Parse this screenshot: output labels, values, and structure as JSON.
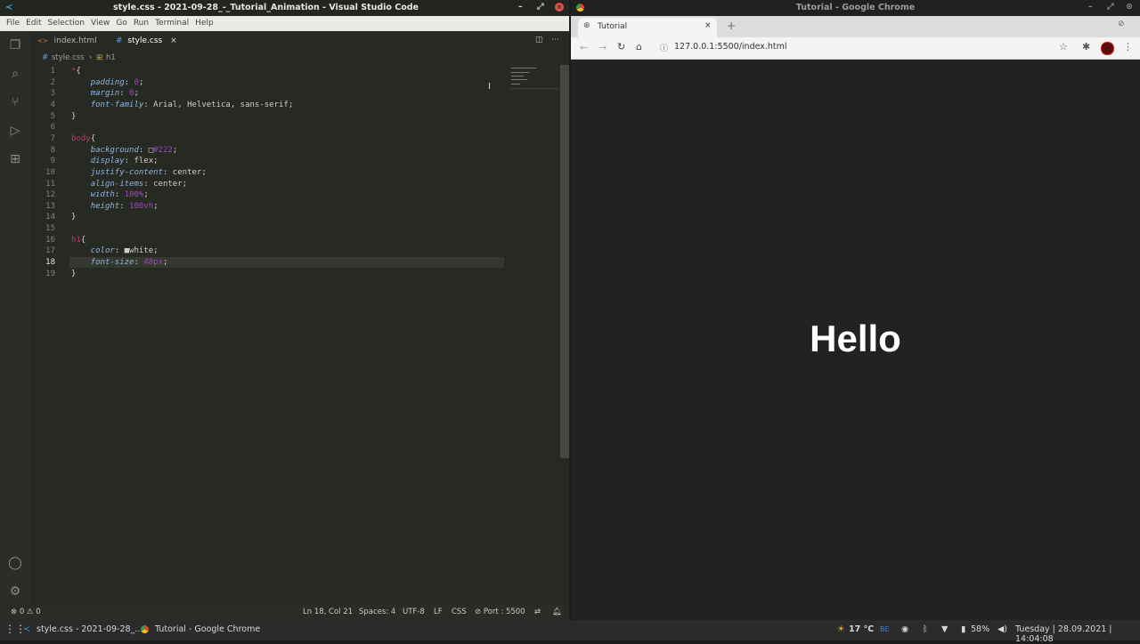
{
  "vscode": {
    "title": "style.css - 2021-09-28_-_Tutorial_Animation - Visual Studio Code",
    "menu": [
      "File",
      "Edit",
      "Selection",
      "View",
      "Go",
      "Run",
      "Terminal",
      "Help"
    ],
    "tabs": [
      {
        "label": "index.html",
        "icon": "<>"
      },
      {
        "label": "style.css",
        "icon": "#"
      }
    ],
    "breadcrumb": {
      "file": "style.css",
      "symbol": "h1"
    },
    "code": [
      {
        "n": "1",
        "parts": [
          [
            "sel",
            "*"
          ],
          [
            "val",
            "{"
          ]
        ]
      },
      {
        "n": "2",
        "parts": [
          [
            "val",
            "    "
          ],
          [
            "prop",
            "padding"
          ],
          [
            "val",
            ": "
          ],
          [
            "num",
            "0"
          ],
          [
            "val",
            ";"
          ]
        ]
      },
      {
        "n": "3",
        "parts": [
          [
            "val",
            "    "
          ],
          [
            "prop",
            "margin"
          ],
          [
            "val",
            ": "
          ],
          [
            "num",
            "0"
          ],
          [
            "val",
            ";"
          ]
        ]
      },
      {
        "n": "4",
        "parts": [
          [
            "val",
            "    "
          ],
          [
            "prop",
            "font-family"
          ],
          [
            "val",
            ": Arial, Helvetica, sans-serif;"
          ]
        ]
      },
      {
        "n": "5",
        "parts": [
          [
            "val",
            "}"
          ]
        ]
      },
      {
        "n": "6",
        "parts": []
      },
      {
        "n": "7",
        "parts": [
          [
            "sel",
            "body"
          ],
          [
            "val",
            "{"
          ]
        ]
      },
      {
        "n": "8",
        "parts": [
          [
            "val",
            "    "
          ],
          [
            "prop",
            "background"
          ],
          [
            "val",
            ": □"
          ],
          [
            "num",
            "#222"
          ],
          [
            "val",
            ";"
          ]
        ]
      },
      {
        "n": "9",
        "parts": [
          [
            "val",
            "    "
          ],
          [
            "prop",
            "display"
          ],
          [
            "val",
            ": flex;"
          ]
        ]
      },
      {
        "n": "10",
        "parts": [
          [
            "val",
            "    "
          ],
          [
            "prop",
            "justify-content"
          ],
          [
            "val",
            ": center;"
          ]
        ]
      },
      {
        "n": "11",
        "parts": [
          [
            "val",
            "    "
          ],
          [
            "prop",
            "align-items"
          ],
          [
            "val",
            ": center;"
          ]
        ]
      },
      {
        "n": "12",
        "parts": [
          [
            "val",
            "    "
          ],
          [
            "prop",
            "width"
          ],
          [
            "val",
            ": "
          ],
          [
            "num",
            "100%"
          ],
          [
            "val",
            ";"
          ]
        ]
      },
      {
        "n": "13",
        "parts": [
          [
            "val",
            "    "
          ],
          [
            "prop",
            "height"
          ],
          [
            "val",
            ": "
          ],
          [
            "num",
            "100vh"
          ],
          [
            "val",
            ";"
          ]
        ]
      },
      {
        "n": "14",
        "parts": [
          [
            "val",
            "}"
          ]
        ]
      },
      {
        "n": "15",
        "parts": []
      },
      {
        "n": "16",
        "parts": [
          [
            "sel",
            "h1"
          ],
          [
            "val",
            "{"
          ]
        ]
      },
      {
        "n": "17",
        "parts": [
          [
            "val",
            "    "
          ],
          [
            "prop",
            "color"
          ],
          [
            "val",
            ": ■white;"
          ]
        ]
      },
      {
        "n": "18",
        "parts": [
          [
            "val",
            "    "
          ],
          [
            "prop",
            "font-size"
          ],
          [
            "val",
            ": "
          ],
          [
            "num",
            "48px"
          ],
          [
            "val",
            ";"
          ]
        ]
      },
      {
        "n": "19",
        "parts": [
          [
            "val",
            "}"
          ]
        ]
      }
    ],
    "status": {
      "problems": "⊗ 0 ⚠ 0",
      "position": "Ln 18, Col 21",
      "spaces": "Spaces: 4",
      "encoding": "UTF-8",
      "eol": "LF",
      "language": "CSS",
      "port": "⊘ Port : 5500"
    }
  },
  "chrome": {
    "title": "Tutorial - Google Chrome",
    "tab_label": "Tutorial",
    "url": "127.0.0.1:5500/index.html",
    "page_heading": "Hello"
  },
  "taskbar": {
    "vscode_item": "style.css - 2021-09-28_...",
    "chrome_item": "Tutorial - Google Chrome",
    "weather": "17 °C",
    "battery": "58%",
    "datetime": "Tuesday | 28.09.2021 | 14:04:08",
    "lang": "BE"
  },
  "colors": {
    "page_bg": "#222222",
    "editor_bg": "#272a23",
    "accent": "#1e90ff"
  }
}
